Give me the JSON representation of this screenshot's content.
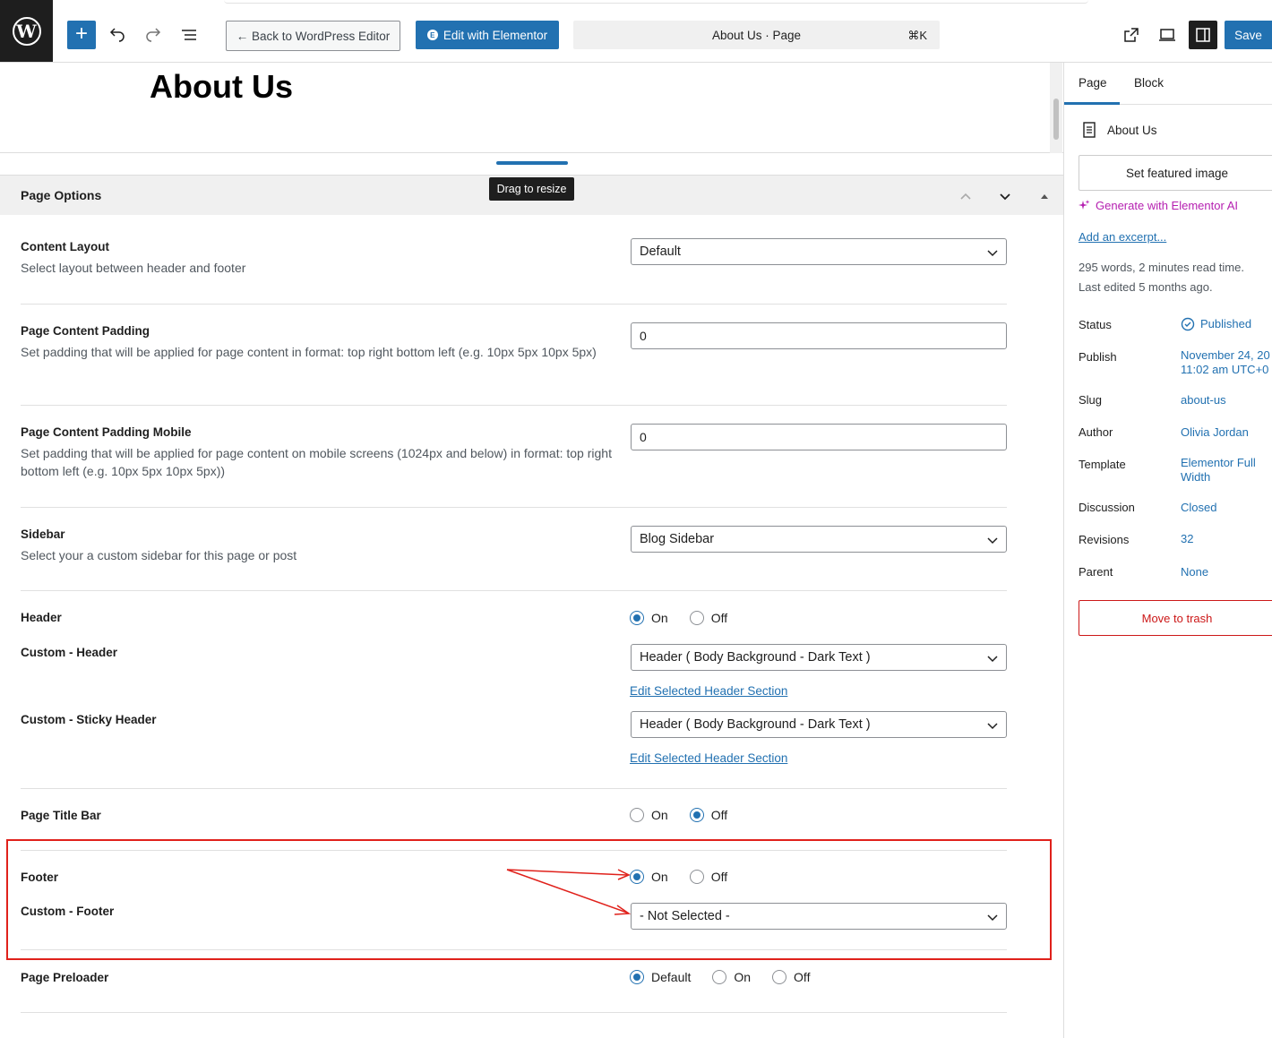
{
  "toolbar": {
    "back_label": "← Back to WordPress Editor",
    "elementor_label": "Edit with Elementor",
    "command_title": "About Us · Page",
    "command_shortcut": "⌘K",
    "save_label": "Save"
  },
  "editor": {
    "page_title": "About Us",
    "resize_tooltip": "Drag to resize"
  },
  "page_options": {
    "title": "Page Options",
    "content_layout": {
      "label": "Content Layout",
      "desc": "Select layout between header and footer",
      "value": "Default"
    },
    "padding": {
      "label": "Page Content Padding",
      "desc": "Set padding that will be applied for page content in format: top right bottom left (e.g. 10px 5px 10px 5px)",
      "value": "0"
    },
    "padding_mobile": {
      "label": "Page Content Padding Mobile",
      "desc": "Set padding that will be applied for page content on mobile screens (1024px and below) in format: top right bottom left (e.g. 10px 5px 10px 5px))",
      "value": "0"
    },
    "sidebar": {
      "label": "Sidebar",
      "desc": "Select your a custom sidebar for this page or post",
      "value": "Blog Sidebar"
    },
    "header": {
      "label": "Header",
      "on": "On",
      "off": "Off",
      "selected": "On"
    },
    "custom_header": {
      "label": "Custom - Header",
      "value": "Header ( Body Background - Dark Text )",
      "link": "Edit Selected Header Section"
    },
    "sticky_header": {
      "label": "Custom - Sticky Header",
      "value": "Header ( Body Background - Dark Text )",
      "link": "Edit Selected Header Section"
    },
    "title_bar": {
      "label": "Page Title Bar",
      "on": "On",
      "off": "Off",
      "selected": "Off"
    },
    "footer": {
      "label": "Footer",
      "on": "On",
      "off": "Off",
      "selected": "On"
    },
    "custom_footer": {
      "label": "Custom - Footer",
      "value": "- Not Selected -"
    },
    "preloader": {
      "label": "Page Preloader",
      "default": "Default",
      "on": "On",
      "off": "Off",
      "selected": "Default"
    }
  },
  "sidebar": {
    "tab_page": "Page",
    "tab_block": "Block",
    "doc_title": "About Us",
    "featured_label": "Set featured image",
    "ai_label": "Generate with Elementor AI",
    "excerpt_label": "Add an excerpt...",
    "word_count": "295 words, 2 minutes read time.",
    "last_edited": "Last edited 5 months ago.",
    "rows": {
      "status_label": "Status",
      "status_value": "Published",
      "publish_label": "Publish",
      "publish_value_1": "November 24, 20",
      "publish_value_2": "11:02 am UTC+0",
      "slug_label": "Slug",
      "slug_value": "about-us",
      "author_label": "Author",
      "author_value": "Olivia Jordan",
      "template_label": "Template",
      "template_value_1": "Elementor Full",
      "template_value_2": "Width",
      "discussion_label": "Discussion",
      "discussion_value": "Closed",
      "revisions_label": "Revisions",
      "revisions_value": "32",
      "parent_label": "Parent",
      "parent_value": "None"
    },
    "trash_label": "Move to trash"
  },
  "colors": {
    "accent": "#2271b1",
    "highlight": "#e0211b",
    "ai": "#b51fb0",
    "danger": "#cc1818"
  }
}
